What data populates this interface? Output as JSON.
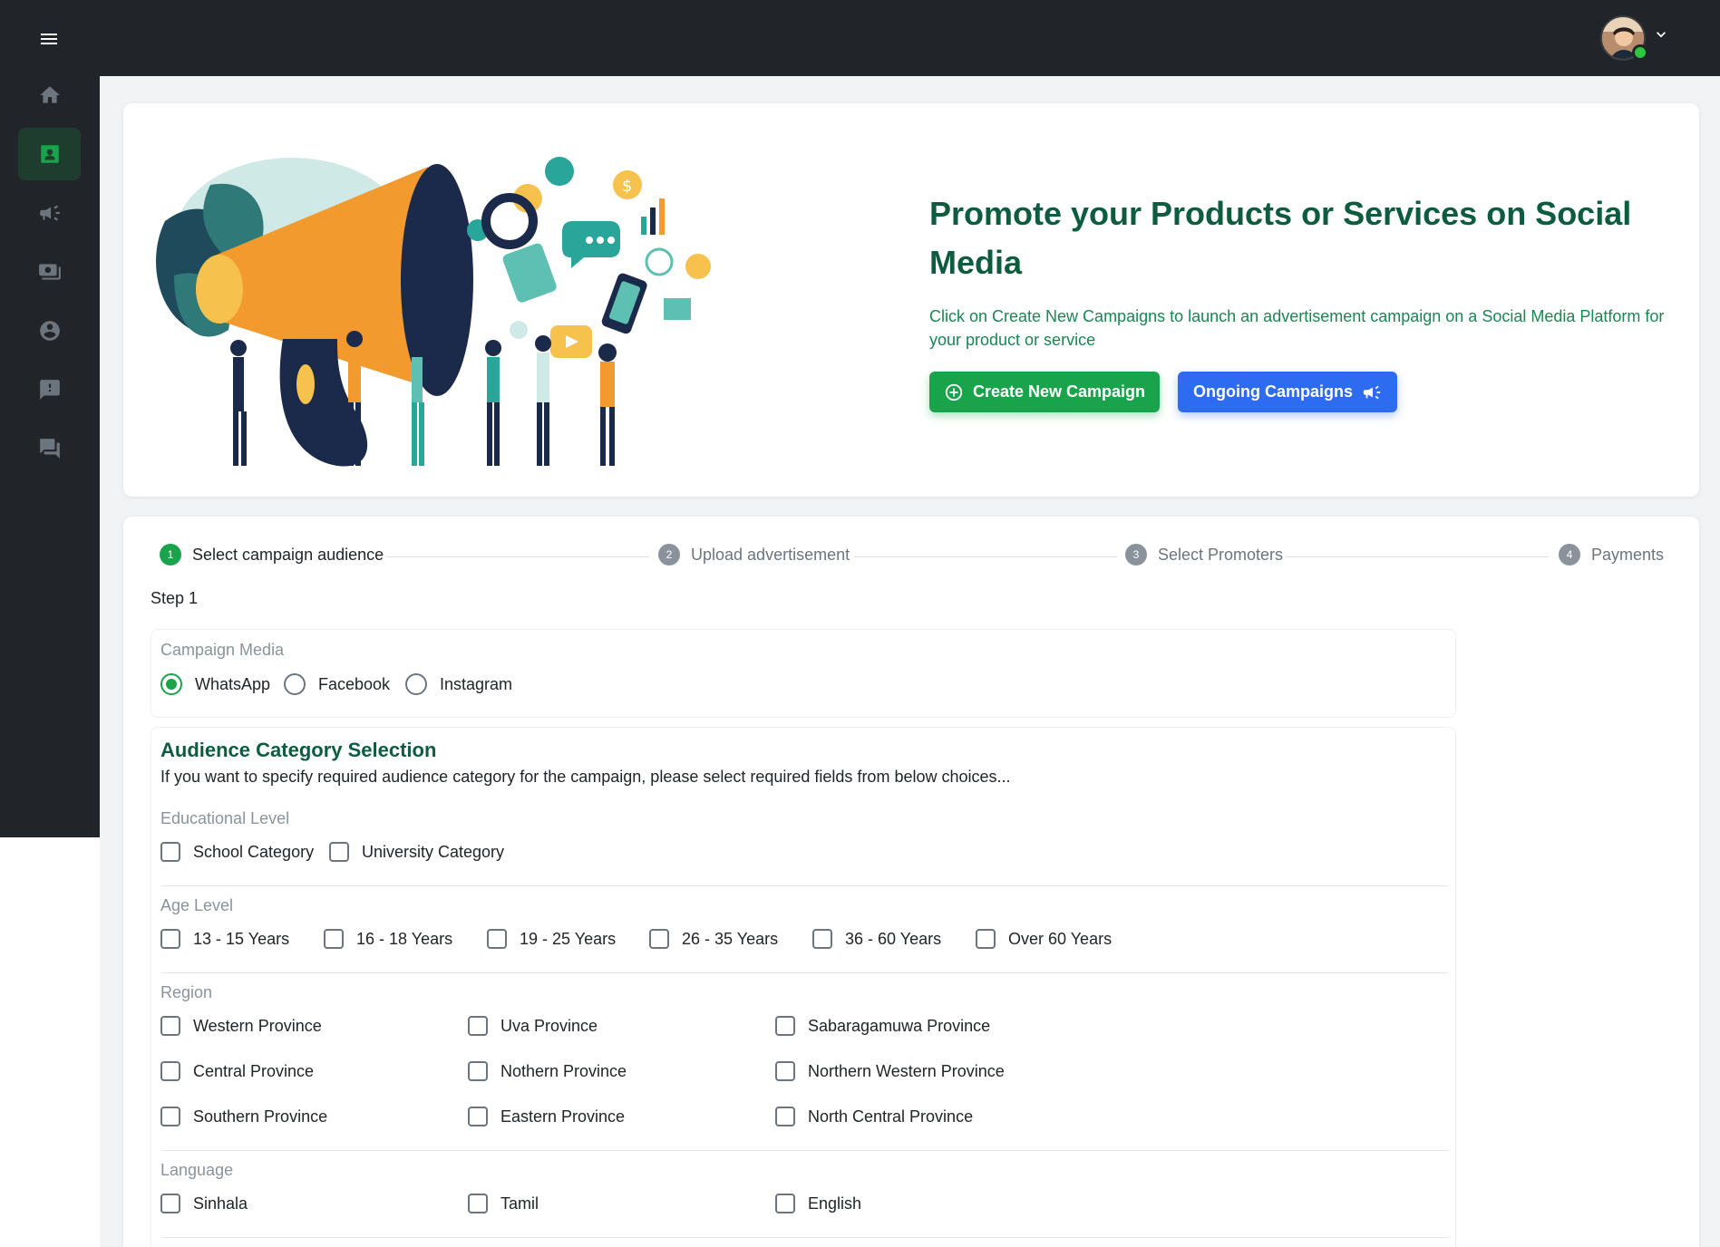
{
  "sidebar": {
    "items": [
      {
        "icon": "menu-icon"
      },
      {
        "icon": "home-icon"
      },
      {
        "icon": "contact-card-icon",
        "active": true
      },
      {
        "icon": "megaphone-icon"
      },
      {
        "icon": "money-icon"
      },
      {
        "icon": "account-icon"
      },
      {
        "icon": "feedback-icon"
      },
      {
        "icon": "chat-icon"
      }
    ]
  },
  "hero": {
    "title": "Promote your Products or Services on Social Media",
    "description": "Click on Create New Campaigns to launch an advertisement campaign on a Social Media Platform for your product or service",
    "create_label": "Create New Campaign",
    "ongoing_label": "Ongoing Campaigns"
  },
  "stepper": {
    "steps": [
      {
        "num": "1",
        "label": "Select campaign audience"
      },
      {
        "num": "2",
        "label": "Upload advertisement"
      },
      {
        "num": "3",
        "label": "Select Promoters"
      },
      {
        "num": "4",
        "label": "Payments"
      }
    ],
    "current": "Step 1"
  },
  "media": {
    "label": "Campaign Media",
    "options": [
      "WhatsApp",
      "Facebook",
      "Instagram"
    ],
    "selected": "WhatsApp"
  },
  "audience": {
    "title": "Audience Category Selection",
    "description": "If you want to specify required audience category for the campaign, please select required fields from below choices...",
    "education": {
      "label": "Educational Level",
      "options": [
        "School Category",
        "University Category"
      ]
    },
    "age": {
      "label": "Age Level",
      "options": [
        "13 - 15 Years",
        "16 - 18 Years",
        "19 - 25 Years",
        "26 - 35 Years",
        "36 - 60 Years",
        "Over 60 Years"
      ]
    },
    "region": {
      "label": "Region",
      "options": [
        "Western Province",
        "Uva Province",
        "Sabaragamuwa Province",
        "Central Province",
        "Nothern Province",
        "Northern Western Province",
        "Southern Province",
        "Eastern Province",
        "North Central Province"
      ]
    },
    "language": {
      "label": "Language",
      "options": [
        "Sinhala",
        "Tamil",
        "English"
      ]
    }
  },
  "colors": {
    "accent_green": "#19a34a",
    "accent_blue": "#2d6bf0",
    "title_green": "#0d5c3f",
    "sidebar_bg": "#212529"
  }
}
